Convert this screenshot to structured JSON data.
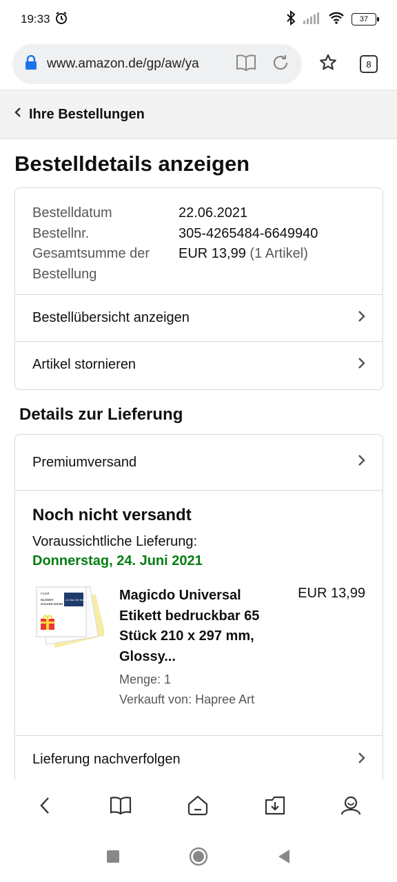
{
  "status": {
    "time": "19:33",
    "battery": "37"
  },
  "browser": {
    "url": "www.amazon.de/gp/aw/ya",
    "tab_count": "8"
  },
  "nav": {
    "back_label": "Ihre Bestellungen"
  },
  "page": {
    "title": "Bestelldetails anzeigen"
  },
  "summary": {
    "date_label": "Bestelldatum",
    "date_value": "22.06.2021",
    "order_label": "Bestellnr.",
    "order_value": "305-4265484-6649940",
    "total_label": "Gesamtsumme der Bestellung",
    "total_value": "EUR 13,99",
    "total_items": "(1 Artikel)",
    "link_overview": "Bestellübersicht anzeigen",
    "link_cancel": "Artikel stornieren"
  },
  "delivery": {
    "heading": "Details zur Lieferung",
    "shipping_method": "Premiumversand",
    "status": "Noch nicht versandt",
    "expected_label": "Voraussichtliche Lieferung:",
    "expected_date": "Donnerstag, 24. Juni 2021",
    "item": {
      "title": "Magicdo Universal Etikett bedruckbar 65 Stück 210 x 297 mm, Glossy...",
      "quantity": "Menge: 1",
      "seller": "Verkauft von: Hapree Art",
      "price": "EUR 13,99",
      "thumb_brand": "i-Lext",
      "thumb_line1": "GLOSSY",
      "thumb_line2": "STICKER PAPER",
      "thumb_badge": "A4 Size 65 Sheets"
    },
    "track_link": "Lieferung nachverfolgen"
  },
  "colors": {
    "green": "#067d12",
    "lock": "#1a73e8",
    "border": "#d5d9d9"
  }
}
